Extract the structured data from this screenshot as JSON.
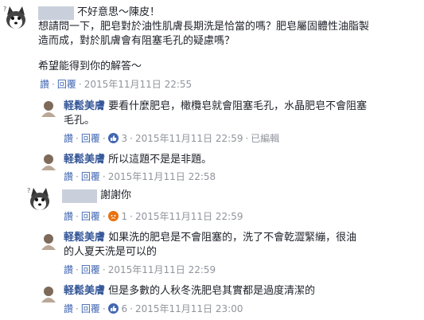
{
  "comments": [
    {
      "text_lines": [
        "不好意思～陳皮！",
        "想請問一下，肥皂對於油性肌膚長期洗是恰當的嗎？肥皂屬固體性油脂製",
        "造而成，對於肌膚會有阻塞毛孔的疑慮嗎？",
        "希望能得到你的解答～"
      ],
      "actions": [
        "讚",
        "回覆"
      ],
      "timestamp": "2015年11月11日 22:55"
    },
    {
      "name": "軽鬆美膚",
      "text_lines": [
        "要看什麼肥皂，橄欖皂就會阻塞毛孔，水晶肥皂不會阻塞",
        "毛孔。"
      ],
      "actions": [
        "讚",
        "回覆"
      ],
      "reactions": "3",
      "timestamp": "2015年11月11日 22:59",
      "edited": "已編輯"
    },
    {
      "name": "軽鬆美膚",
      "text_lines": [
        "所以這題不是是非題。"
      ],
      "actions": [
        "讚",
        "回覆"
      ],
      "timestamp": "2015年11月11日 22:58"
    },
    {
      "text_lines": [
        "謝謝你"
      ],
      "actions": [
        "讚",
        "回覆"
      ],
      "reactions": "1",
      "timestamp": "2015年11月11日 22:59"
    },
    {
      "name": "軽鬆美膚",
      "text_lines": [
        "如果洗的肥皂是不會阻塞的，洗了不會乾澀緊繃，很油",
        "的人夏天洗是可以的"
      ],
      "actions": [
        "讚",
        "回覆"
      ],
      "timestamp": "2015年11月11日 22:59"
    },
    {
      "name": "軽鬆美膚",
      "text_lines": [
        "但是多數的人秋冬洗肥皂其實都是過度清潔的"
      ],
      "actions": [
        "讚",
        "回覆"
      ],
      "reactions": "6",
      "timestamp": "2015年11月11日 23:00"
    }
  ],
  "separator": "·",
  "icons": {
    "avatar_user": "husky-dog-avatar",
    "avatar_page": "page-logo-avatar",
    "reaction_like": "like-icon",
    "reaction_angry": "angry-icon"
  },
  "colors": {
    "link": "#365899",
    "meta": "#90949c",
    "action": "#4267b2",
    "angry": "#e9710f"
  }
}
